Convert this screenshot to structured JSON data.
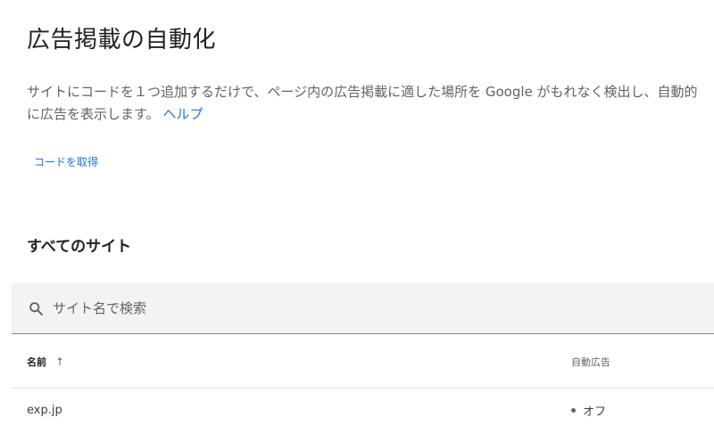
{
  "header": {
    "title": "広告掲載の自動化",
    "description": "サイトにコードを１つ追加するだけで、ページ内の広告掲載に適した場所を Google がもれなく検出し、自動的に広告を表示します。",
    "help_link": "ヘルプ"
  },
  "actions": {
    "get_code_label": "コードを取得"
  },
  "sites_section": {
    "title": "すべてのサイト",
    "search": {
      "placeholder": "サイト名で検索",
      "value": ""
    },
    "table": {
      "columns": [
        {
          "label": "名前",
          "sort": "ascending",
          "sort_icon": "arrow-up-icon"
        },
        {
          "label": "自動広告"
        }
      ],
      "rows": [
        {
          "site": "exp.jp",
          "auto_ads": "オフ"
        }
      ]
    }
  },
  "colors": {
    "link": "#1a73e8",
    "title": "#202124",
    "secondary_text": "#5f6368",
    "search_background": "#f1f3f4"
  }
}
